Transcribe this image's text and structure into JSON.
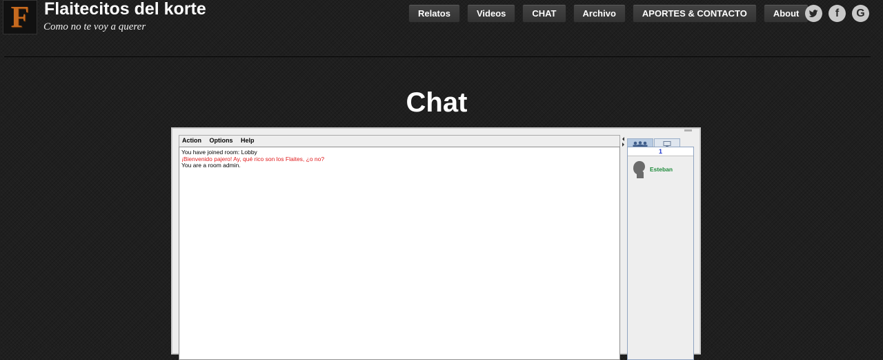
{
  "site": {
    "logo_letter": "F",
    "title": "Flaitecitos del korte",
    "tagline": "Como no te voy a querer"
  },
  "nav": {
    "items": [
      "Relatos",
      "Videos",
      "CHAT",
      "Archivo",
      "APORTES & CONTACTO",
      "About"
    ]
  },
  "social": [
    {
      "icon": "twitter-icon"
    },
    {
      "icon": "facebook-icon",
      "glyph": "f"
    },
    {
      "icon": "google-icon",
      "glyph": "G"
    }
  ],
  "page": {
    "title": "Chat"
  },
  "chat": {
    "menu": [
      "Action",
      "Options",
      "Help"
    ],
    "messages": [
      {
        "text": "You have joined room: Lobby",
        "color": "#000000"
      },
      {
        "text": "¡Bienvenido pajero! Ay, qué rico son los Flaites, ¿o no?",
        "color": "#e0181a"
      },
      {
        "text": "You are a room admin.",
        "color": "#000000"
      }
    ],
    "user_count": "1",
    "users": [
      {
        "name": "Esteban",
        "color": "#1d8a3a"
      }
    ]
  }
}
